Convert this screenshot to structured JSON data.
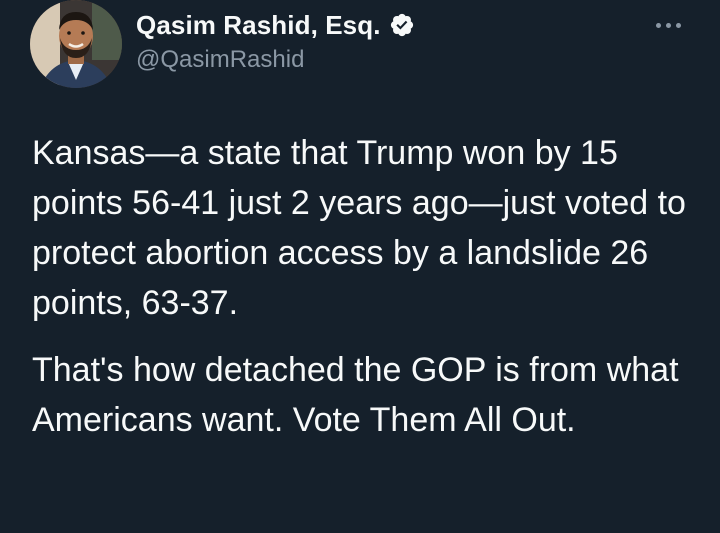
{
  "tweet": {
    "author": {
      "display_name": "Qasim Rashid, Esq.",
      "handle": "@QasimRashid",
      "verified": true,
      "avatar_icon": "profile-photo"
    },
    "paragraphs": [
      "Kansas—a state that Trump won by 15 points 56-41 just 2 years ago—just voted to protect abortion access by a landslide 26 points, 63-37.",
      "That's how detached the GOP is from what Americans want. Vote Them All Out."
    ],
    "more_icon": "more-options-icon"
  },
  "colors": {
    "background": "#15202b",
    "text_primary": "#f7f9f9",
    "text_secondary": "#8b98a5",
    "verified_badge": "#f7f9f9"
  }
}
